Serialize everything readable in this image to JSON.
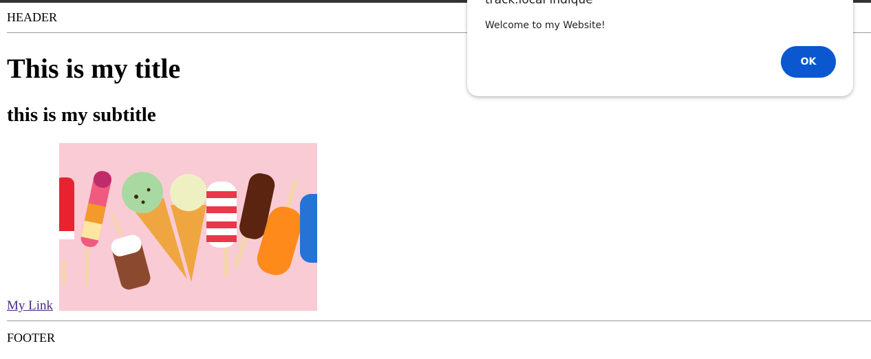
{
  "page": {
    "header": "HEADER",
    "title": "This is my title",
    "subtitle": "this is my subtitle",
    "link_label": "My Link",
    "footer": "FOOTER",
    "image": {
      "description_icon": "ice-cream-photo",
      "background": "#f9cbd5"
    }
  },
  "dialog": {
    "title": "track.local indique",
    "message": "Welcome to my Website!",
    "ok_label": "OK",
    "ok_color": "#0b57d0"
  },
  "colors": {
    "link": "#4b2a82",
    "rule": "#9a9a9a",
    "topbar": "#333333"
  }
}
